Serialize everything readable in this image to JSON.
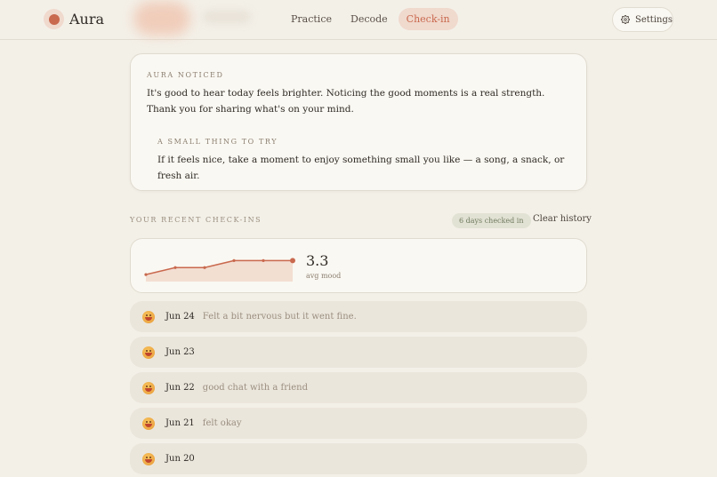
{
  "app": {
    "name": "Aura"
  },
  "nav": {
    "items": [
      {
        "label": "Practice",
        "active": false
      },
      {
        "label": "Decode",
        "active": false
      },
      {
        "label": "Check-in",
        "active": true
      }
    ]
  },
  "header": {
    "settings_label": "Settings"
  },
  "noticed": {
    "eyebrow": "AURA NOTICED",
    "text": "It's good to hear today feels brighter. Noticing the good moments is a real strength. Thank you for sharing what's on your mind."
  },
  "try": {
    "eyebrow": "A SMALL THING TO TRY",
    "text": "If it feels nice, take a moment to enjoy something small you like — a song, a snack, or fresh air."
  },
  "recent": {
    "title": "YOUR RECENT CHECK-INS",
    "days_badge": "6 days checked in",
    "clear_label": "Clear history"
  },
  "mood": {
    "avg_value": "3.3",
    "avg_label": "avg mood",
    "chart_data": {
      "type": "area",
      "values": [
        2,
        3,
        3,
        4,
        4,
        4
      ],
      "ylim": [
        1,
        5
      ],
      "color": "#c9694e",
      "fill": "#f3ded2"
    }
  },
  "entries": [
    {
      "date": "Jun 24",
      "note": "Felt a bit nervous but it went fine."
    },
    {
      "date": "Jun 23",
      "note": ""
    },
    {
      "date": "Jun 22",
      "note": "good chat with a friend"
    },
    {
      "date": "Jun 21",
      "note": "felt okay"
    },
    {
      "date": "Jun 20",
      "note": ""
    }
  ],
  "colors": {
    "accent": "#c9694e",
    "background": "#f3f0e8",
    "card": "#faf8f2"
  }
}
